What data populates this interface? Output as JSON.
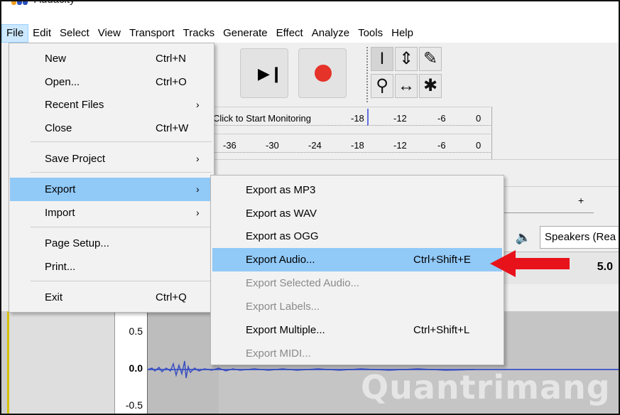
{
  "window": {
    "title": "Audacity"
  },
  "colors": {
    "accent_highlight": "#91c9f7",
    "menu_active": "#cce8ff",
    "record": "#e5332a",
    "annotation_arrow": "#e8121b",
    "meter_cursor": "#6470e0"
  },
  "menubar": [
    "File",
    "Edit",
    "Select",
    "View",
    "Transport",
    "Tracks",
    "Generate",
    "Effect",
    "Analyze",
    "Tools",
    "Help"
  ],
  "file_menu": {
    "items": [
      {
        "label": "New",
        "shortcut": "Ctrl+N"
      },
      {
        "label": "Open...",
        "shortcut": "Ctrl+O"
      },
      {
        "label": "Recent Files",
        "submenu": true
      },
      {
        "label": "Close",
        "shortcut": "Ctrl+W"
      },
      {
        "label": "Save Project",
        "submenu": true
      },
      {
        "label": "Export",
        "submenu": true,
        "highlighted": true
      },
      {
        "label": "Import",
        "submenu": true
      },
      {
        "label": "Page Setup..."
      },
      {
        "label": "Print..."
      },
      {
        "label": "Exit",
        "shortcut": "Ctrl+Q"
      }
    ],
    "submenu_arrow": "›"
  },
  "export_menu": {
    "items": [
      {
        "label": "Export as MP3"
      },
      {
        "label": "Export as WAV"
      },
      {
        "label": "Export as OGG"
      },
      {
        "label": "Export Audio...",
        "shortcut": "Ctrl+Shift+E",
        "highlighted": true
      },
      {
        "label": "Export Selected Audio...",
        "disabled": true
      },
      {
        "label": "Export Labels...",
        "disabled": true
      },
      {
        "label": "Export Multiple...",
        "shortcut": "Ctrl+Shift+L"
      },
      {
        "label": "Export MIDI...",
        "disabled": true
      }
    ]
  },
  "toolbar": {
    "skip_end_icon": "skip-to-end-icon",
    "record_icon": "record-icon",
    "tools": [
      "selection-tool-icon",
      "envelope-tool-icon",
      "draw-tool-icon",
      "zoom-tool-icon",
      "timeshift-tool-icon",
      "multi-tool-icon"
    ]
  },
  "meters": {
    "record_meter": {
      "prompt": "Click to Start Monitoring",
      "ticks": [
        "-18",
        "-12",
        "-6",
        "0"
      ]
    },
    "playback_meter": {
      "ticks": [
        "-36",
        "-30",
        "-24",
        "-18",
        "-12",
        "-6",
        "0"
      ]
    }
  },
  "device": {
    "speaker_icon": "speaker-icon",
    "output": "Speakers (Rea"
  },
  "timeline": {
    "value": "5.0"
  },
  "track": {
    "y_labels": [
      "0.5",
      "0.0",
      "-0.5"
    ]
  },
  "watermark": "Quantrimang"
}
